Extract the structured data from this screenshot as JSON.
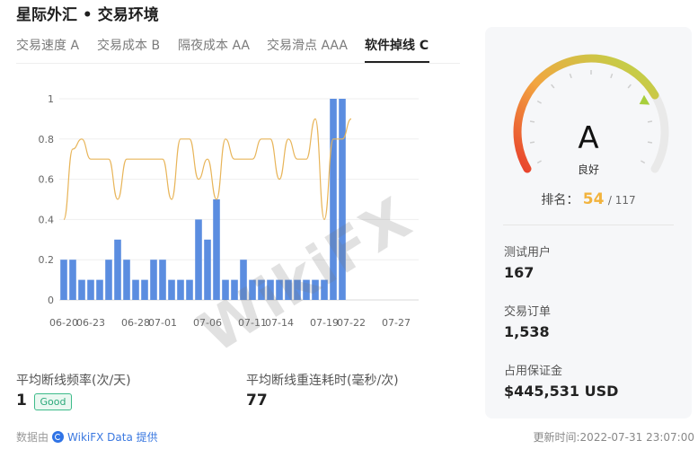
{
  "header": {
    "title": "星际外汇 • 交易环境"
  },
  "tabs": [
    {
      "label": "交易速度 A"
    },
    {
      "label": "交易成本 B"
    },
    {
      "label": "隔夜成本 AA"
    },
    {
      "label": "交易滑点 AAA"
    },
    {
      "label": "软件掉线 C"
    }
  ],
  "chart_data": {
    "type": "bar",
    "categories": [
      "06-20",
      "06-21",
      "06-22",
      "06-23",
      "06-24",
      "06-25",
      "06-26",
      "06-27",
      "06-28",
      "06-29",
      "06-30",
      "07-01",
      "07-02",
      "07-03",
      "07-04",
      "07-05",
      "07-06",
      "07-07",
      "07-08",
      "07-09",
      "07-10",
      "07-11",
      "07-12",
      "07-13",
      "07-14",
      "07-15",
      "07-16",
      "07-17",
      "07-18",
      "07-19",
      "07-20",
      "07-21",
      "07-22",
      "07-23",
      "07-24",
      "07-25",
      "07-26",
      "07-27",
      "07-28",
      "07-29"
    ],
    "tick_labels": [
      "06-20",
      "06-23",
      "06-28",
      "07-01",
      "07-06",
      "07-11",
      "07-14",
      "07-19",
      "07-22",
      "07-27"
    ],
    "series": [
      {
        "type": "bar",
        "values": [
          0.2,
          0.2,
          0.1,
          0.1,
          0.1,
          0.2,
          0.3,
          0.2,
          0.1,
          0.1,
          0.2,
          0.2,
          0.1,
          0.1,
          0.1,
          0.4,
          0.3,
          0.5,
          0.1,
          0.1,
          0.2,
          0.1,
          0.1,
          0.1,
          0.1,
          0.1,
          0.1,
          0.1,
          0.1,
          0.1,
          1,
          1,
          0,
          0,
          0,
          0,
          0,
          0,
          0,
          0
        ]
      },
      {
        "type": "line",
        "values": [
          0.4,
          0.75,
          0.8,
          0.7,
          0.7,
          0.7,
          0.5,
          0.7,
          0.7,
          0.7,
          0.7,
          0.7,
          0.5,
          0.8,
          0.8,
          0.6,
          0.7,
          0.5,
          0.8,
          0.7,
          0.7,
          0.7,
          0.8,
          0.8,
          0.6,
          0.8,
          0.7,
          0.7,
          0.9,
          0.4,
          0.8,
          0.8,
          0.9
        ]
      }
    ],
    "y_ticks": [
      "0",
      "0.2",
      "0.4",
      "0.6",
      "0.8",
      "1"
    ],
    "ylim": [
      0,
      1
    ],
    "grid": true,
    "colors": {
      "bar": "#5b8de0",
      "line": "#e8b55a"
    }
  },
  "stats": {
    "freq_label": "平均断线频率(次/天)",
    "freq_value": "1",
    "freq_badge": "Good",
    "reconnect_label": "平均断线重连耗时(毫秒/次)",
    "reconnect_value": "77"
  },
  "footer": {
    "source_prefix": "数据由",
    "source_link": "WikiFX Data 提供",
    "updated": "更新时间:2022-07-31 23:07:00"
  },
  "panel": {
    "grade": "A",
    "grade_text": "良好",
    "rank_label": "排名：",
    "rank": "54",
    "rank_total": "/ 117",
    "gauge_level": 0.75,
    "metrics": [
      {
        "label": "测试用户",
        "value": "167"
      },
      {
        "label": "交易订单",
        "value": "1,538"
      },
      {
        "label": "占用保证金",
        "value": "$445,531 USD"
      }
    ]
  },
  "watermark": "WikiFX",
  "colors": {
    "badge_green": "#2aa879",
    "rank_gold": "#f2b33d",
    "link_blue": "#3a78e0"
  }
}
